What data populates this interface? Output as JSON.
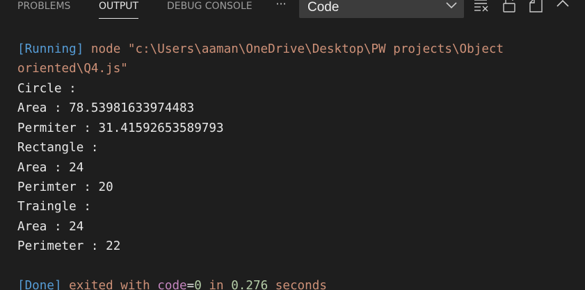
{
  "tabs": {
    "problems": "PROBLEMS",
    "output": "OUTPUT",
    "debug_console": "DEBUG CONSOLE",
    "more": "···"
  },
  "channel_select": {
    "value": "Code"
  },
  "output": {
    "running_tag": "[Running]",
    "command_line1": " node \"c:\\Users\\aaman\\OneDrive\\Desktop\\PW projects\\Object",
    "command_line2": "oriented\\Q4.js\"",
    "lines": [
      "Circle :",
      "Area : 78.53981633974483",
      "Permiter : 31.41592653589793",
      "Rectangle :",
      "Area : 24",
      "Perimter : 20",
      "Traingle :",
      "Area : 24",
      "Perimeter : 22"
    ],
    "done_tag": "[Done]",
    "done_text1": " exited with ",
    "done_code_label": "code",
    "done_equals": "=",
    "done_code_value": "0",
    "done_text2": " in ",
    "done_seconds_value": "0.276",
    "done_text3": " seconds"
  },
  "colors": {
    "background": "#1e1e1e",
    "running_tag": "#569cd6",
    "command": "#ce9178",
    "number": "#b5cea8",
    "code_label": "#c586c0"
  },
  "icons": {
    "more": "more-actions-icon",
    "chevron": "chevron-down-icon",
    "clear": "clear-output-icon",
    "lock": "lock-scroll-icon",
    "open_editor": "open-in-editor-icon",
    "maximize": "chevron-up-icon"
  }
}
